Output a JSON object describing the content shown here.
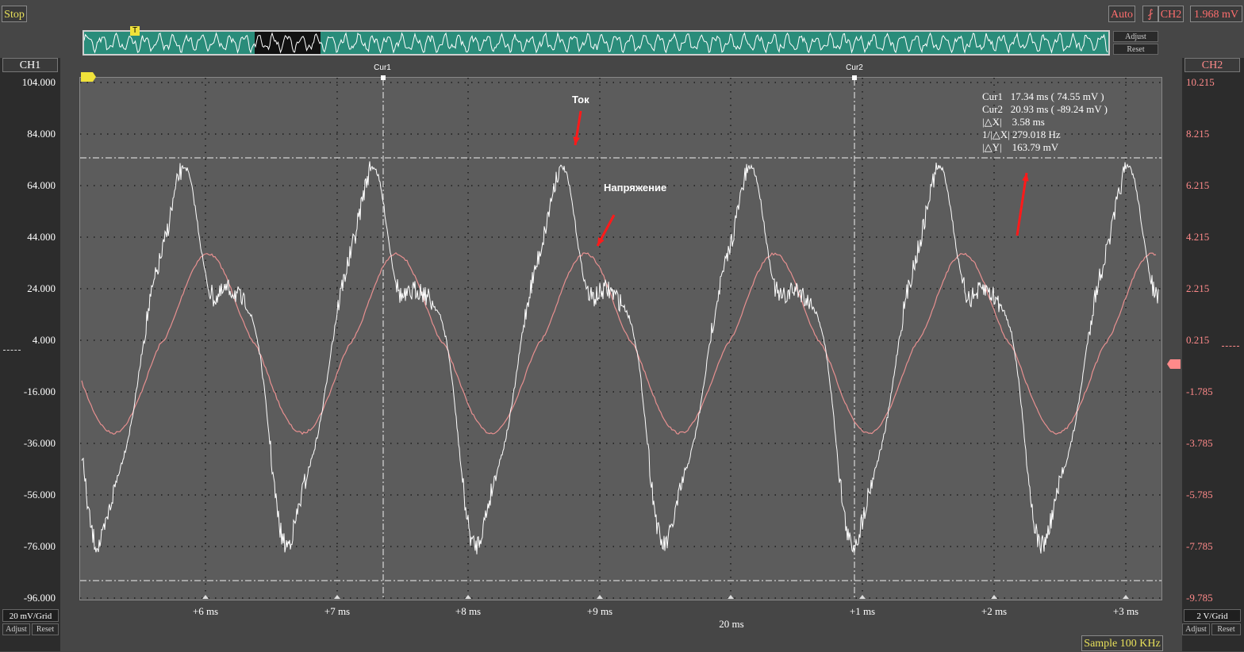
{
  "toolbar": {
    "stop_label": "Stop",
    "auto_label": "Auto",
    "trigger_icon": "trigger-edge-icon",
    "trigger_channel": "CH2",
    "trigger_level": "1.968 mV"
  },
  "overview": {
    "adjust_label": "Adjust",
    "reset_label": "Reset",
    "trigger_marker": "T"
  },
  "ch1": {
    "label": "CH1",
    "scale": "20 mV/Grid",
    "adjust_label": "Adjust",
    "reset_label": "Reset",
    "ticks": [
      "104.000",
      "84.000",
      "64.000",
      "44.000",
      "24.000",
      "4.000",
      "-16.000",
      "-36.000",
      "-56.000",
      "-76.000",
      "-96.000"
    ]
  },
  "ch2": {
    "label": "CH2",
    "scale": "2 V/Grid",
    "adjust_label": "Adjust",
    "reset_label": "Reset",
    "ticks": [
      "10.215",
      "8.215",
      "6.215",
      "4.215",
      "2.215",
      "0.215",
      "-1.785",
      "-3.785",
      "-5.785",
      "-7.785",
      "-9.785"
    ]
  },
  "xaxis": {
    "ticks": [
      "+6 ms",
      "+7 ms",
      "+8 ms",
      "+9 ms",
      "+1 ms",
      "+2 ms",
      "+3 ms"
    ],
    "center_label": "20 ms"
  },
  "cursors": {
    "cur1_label": "Cur1",
    "cur2_label": "Cur2",
    "readout": [
      "Cur1   17.34 ms ( 74.55 mV )",
      "Cur2   20.93 ms ( -89.24 mV )",
      "|△X|    3.58 ms",
      "1/|△X| 279.018 Hz",
      "|△Y|    163.79 mV"
    ]
  },
  "annotations": {
    "current": "Ток",
    "voltage": "Напряжение"
  },
  "status": {
    "sample_rate": "Sample 100 KHz"
  },
  "colors": {
    "ch1_trace": "#ffffff",
    "ch2_trace": "#e89090",
    "overview_bg": "#2a8c7a",
    "accent_yellow": "#e8e05a",
    "arrow_red": "#ff1a1a"
  }
}
